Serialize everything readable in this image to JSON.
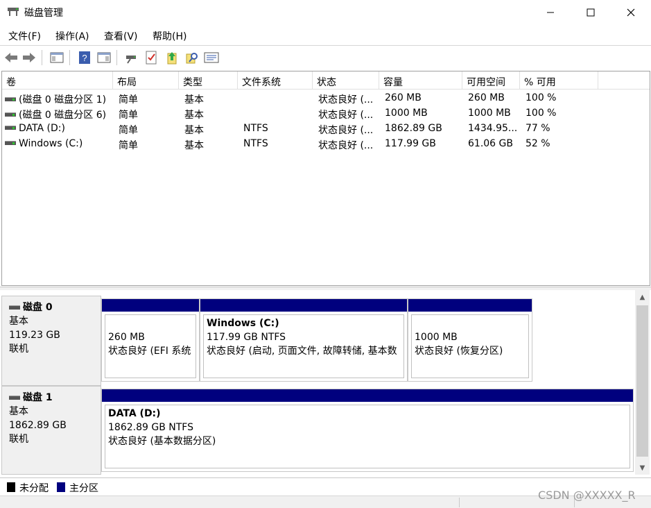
{
  "window": {
    "title": "磁盘管理",
    "app_icon": "disk-management-icon",
    "controls": {
      "minimize_icon": "minimize-icon",
      "maximize_icon": "maximize-icon",
      "close_icon": "close-icon"
    }
  },
  "menu": [
    {
      "label": "文件(F)"
    },
    {
      "label": "操作(A)"
    },
    {
      "label": "查看(V)"
    },
    {
      "label": "帮助(H)"
    }
  ],
  "toolbar": [
    "back-arrow-icon",
    "forward-arrow-icon",
    "console-tree-icon",
    "help-icon",
    "action-pane-icon",
    "connect-drive-icon",
    "checklist-icon",
    "rescan-disk-icon",
    "search-icon",
    "properties-icon"
  ],
  "volume_table": {
    "columns": [
      "卷",
      "布局",
      "类型",
      "文件系统",
      "状态",
      "容量",
      "可用空间",
      "% 可用"
    ],
    "rows": [
      [
        "(磁盘 0 磁盘分区 1)",
        "简单",
        "基本",
        "",
        "状态良好 (...",
        "260 MB",
        "260 MB",
        "100 %"
      ],
      [
        "(磁盘 0 磁盘分区 6)",
        "简单",
        "基本",
        "",
        "状态良好 (...",
        "1000 MB",
        "1000 MB",
        "100 %"
      ],
      [
        "DATA (D:)",
        "简单",
        "基本",
        "NTFS",
        "状态良好 (...",
        "1862.89 GB",
        "1434.95...",
        "77 %"
      ],
      [
        "Windows (C:)",
        "简单",
        "基本",
        "NTFS",
        "状态良好 (...",
        "117.99 GB",
        "61.06 GB",
        "52 %"
      ]
    ]
  },
  "disks": [
    {
      "name": "磁盘 0",
      "type": "基本",
      "size": "119.23 GB",
      "status": "联机",
      "partitions": [
        {
          "name": "",
          "size": "260 MB",
          "status": "状态良好 (EFI 系统"
        },
        {
          "name": "Windows  (C:)",
          "size": "117.99 GB NTFS",
          "status": "状态良好 (启动, 页面文件, 故障转储, 基本数"
        },
        {
          "name": "",
          "size": "1000 MB",
          "status": "状态良好 (恢复分区)"
        }
      ]
    },
    {
      "name": "磁盘 1",
      "type": "基本",
      "size": "1862.89 GB",
      "status": "联机",
      "partitions": [
        {
          "name": "DATA  (D:)",
          "size": "1862.89 GB NTFS",
          "status": "状态良好 (基本数据分区)"
        }
      ]
    }
  ],
  "legend": [
    {
      "label": "未分配",
      "color": "#000000"
    },
    {
      "label": "主分区",
      "color": "#00007e"
    }
  ],
  "colors": {
    "primary_partition": "#00007e",
    "unallocated": "#000000"
  },
  "watermark": "CSDN @XXXXX_R"
}
